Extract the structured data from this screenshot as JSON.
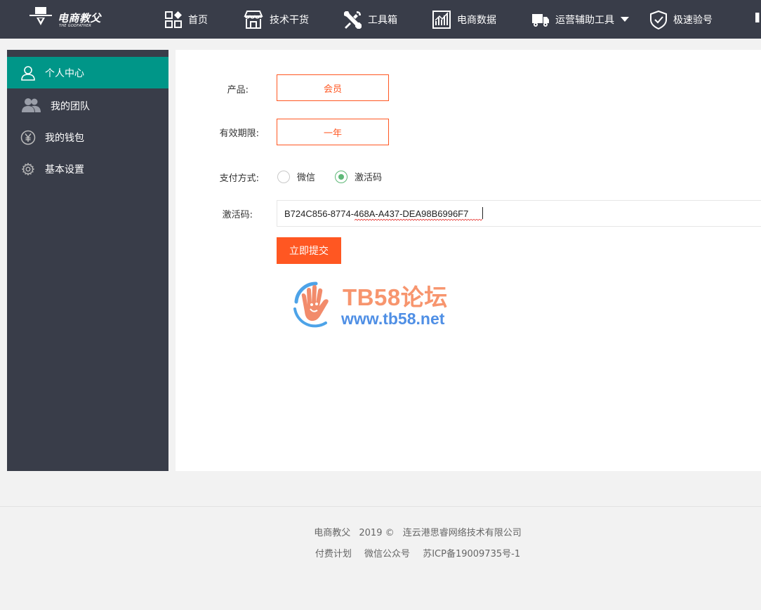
{
  "header": {
    "logo_text": "电商教父",
    "logo_sub": "THE GODFATHER",
    "nav": [
      {
        "label": "首页",
        "icon": "grid-apps-icon"
      },
      {
        "label": "技术干货",
        "icon": "store-icon"
      },
      {
        "label": "工具箱",
        "icon": "tools-icon"
      },
      {
        "label": "电商数据",
        "icon": "chart-icon"
      },
      {
        "label": "运营辅助工具",
        "icon": "truck-icon",
        "has_dropdown": true
      },
      {
        "label": "极速验号",
        "icon": "shield-check-icon"
      }
    ]
  },
  "sidebar": {
    "items": [
      {
        "label": "个人中心",
        "icon": "user-icon",
        "active": true
      },
      {
        "label": "我的团队",
        "icon": "team-icon"
      },
      {
        "label": "我的钱包",
        "icon": "yen-icon"
      },
      {
        "label": "基本设置",
        "icon": "gear-icon"
      }
    ],
    "active_color": "#009688"
  },
  "form": {
    "product_label": "产品:",
    "product_value": "会员",
    "period_label": "有效期限:",
    "period_value": "一年",
    "payment_label": "支付方式:",
    "payment_options": [
      {
        "label": "微信",
        "checked": false
      },
      {
        "label": "激活码",
        "checked": true
      }
    ],
    "code_label": "激活码:",
    "code_value": "B724C856-8774-468A-A437-DEA98B6996F7",
    "submit_label": "立即提交",
    "accent_color": "#ff5722"
  },
  "watermark": {
    "title": "TB58论坛",
    "url": "www.tb58.net"
  },
  "footer": {
    "brand": "电商教父",
    "year": "2019 ©",
    "company": "连云港思睿网络技术有限公司",
    "links": [
      "付费计划",
      "微信公众号",
      "苏ICP备19009735号-1"
    ]
  }
}
